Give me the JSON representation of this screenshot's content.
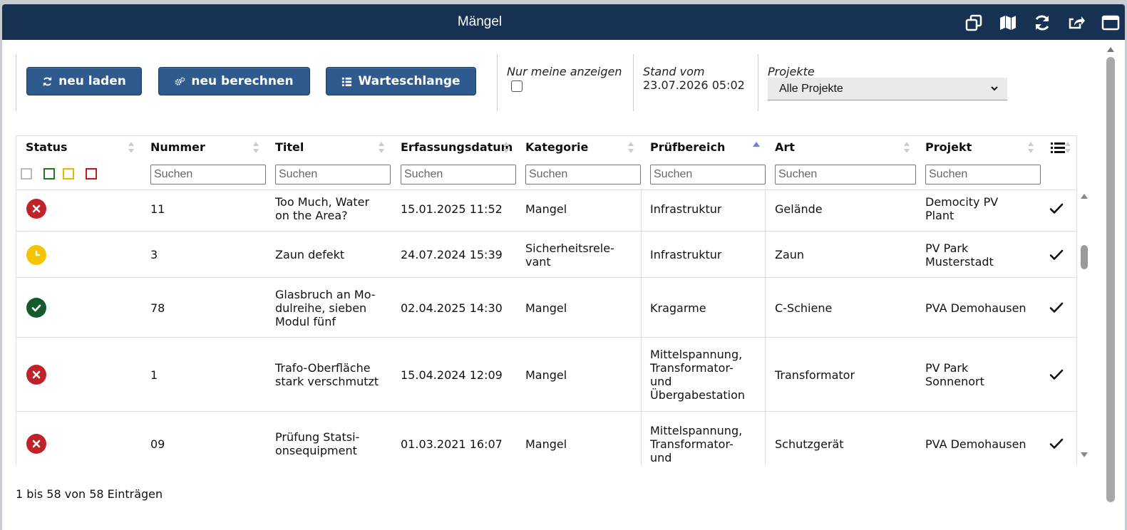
{
  "window": {
    "title": "Mängel"
  },
  "titlebar_icons": [
    "window-restore-icon",
    "map-icon",
    "refresh-icon",
    "share-icon",
    "maximize-icon"
  ],
  "toolbar": {
    "reload_label": "neu laden",
    "recalc_label": "neu berechnen",
    "queue_label": "Warteschlange",
    "only_mine_label": "Nur meine anzeigen",
    "only_mine_checked": false,
    "stand_label": "Stand vom",
    "stand_value": "23.07.2026 05:02",
    "projects_label": "Projekte",
    "projects_selected": "Alle Projekte"
  },
  "table": {
    "columns": [
      "Status",
      "Nummer",
      "Titel",
      "Erfassungsdatum",
      "Kategorie",
      "Prüfbereich",
      "Art",
      "Projekt"
    ],
    "search_placeholder": "Suchen",
    "sorted_column": "Prüfbereich",
    "status_filters": [
      {
        "color": "#bbbbbb"
      },
      {
        "color": "#1e7a1e"
      },
      {
        "color": "#e0b800"
      },
      {
        "color": "#d01515"
      }
    ],
    "rows": [
      {
        "status": "error",
        "nummer": "11",
        "titel": [
          "Too Much, Water",
          "on the Area?"
        ],
        "datum": "15.01.2025 11:52",
        "kategorie": [
          "Mangel"
        ],
        "pruef": [
          "Infrastruktur"
        ],
        "art": "Gelände",
        "projekt": [
          "Democity PV",
          "Plant"
        ],
        "done": true
      },
      {
        "status": "pending",
        "nummer": "3",
        "titel": [
          "Zaun defekt"
        ],
        "datum": "24.07.2024 15:39",
        "kategorie": [
          "Sicherheitsrele-",
          "vant"
        ],
        "pruef": [
          "Infrastruktur"
        ],
        "art": "Zaun",
        "projekt": [
          "PV Park",
          "Musterstadt"
        ],
        "done": true
      },
      {
        "status": "ok",
        "nummer": "78",
        "titel": [
          "Glasbruch an Mo-",
          "dulreihe, sieben",
          "Modul fünf"
        ],
        "datum": "02.04.2025 14:30",
        "kategorie": [
          "Mangel"
        ],
        "pruef": [
          "Kragarme"
        ],
        "art": "C-Schiene",
        "projekt": [
          "PVA Demohausen"
        ],
        "done": true
      },
      {
        "status": "error",
        "nummer": "1",
        "titel": [
          "Trafo-Oberfläche",
          "stark verschmutzt"
        ],
        "datum": "15.04.2024 12:09",
        "kategorie": [
          "Mangel"
        ],
        "pruef": [
          "Mittelspannung,",
          "Transformator-",
          "und",
          "Übergabestation"
        ],
        "art": "Transformator",
        "projekt": [
          "PV Park",
          "Sonnenort"
        ],
        "done": true
      },
      {
        "status": "error",
        "nummer": "09",
        "titel": [
          "Prüfung Statsi-",
          "onsequipment"
        ],
        "datum": "01.03.2021 16:07",
        "kategorie": [
          "Mangel"
        ],
        "pruef": [
          "Mittelspannung,",
          "Transformator-",
          "und"
        ],
        "art": "Schutzgerät",
        "projekt": [
          "PVA Demohausen"
        ],
        "done": true
      }
    ]
  },
  "footer": {
    "info": "1 bis 58 von 58 Einträgen"
  },
  "colors": {
    "titlebar": "#163152",
    "button": "#2e5a8e",
    "error": "#c0222a",
    "pending": "#f5c400",
    "ok": "#145a2c"
  }
}
